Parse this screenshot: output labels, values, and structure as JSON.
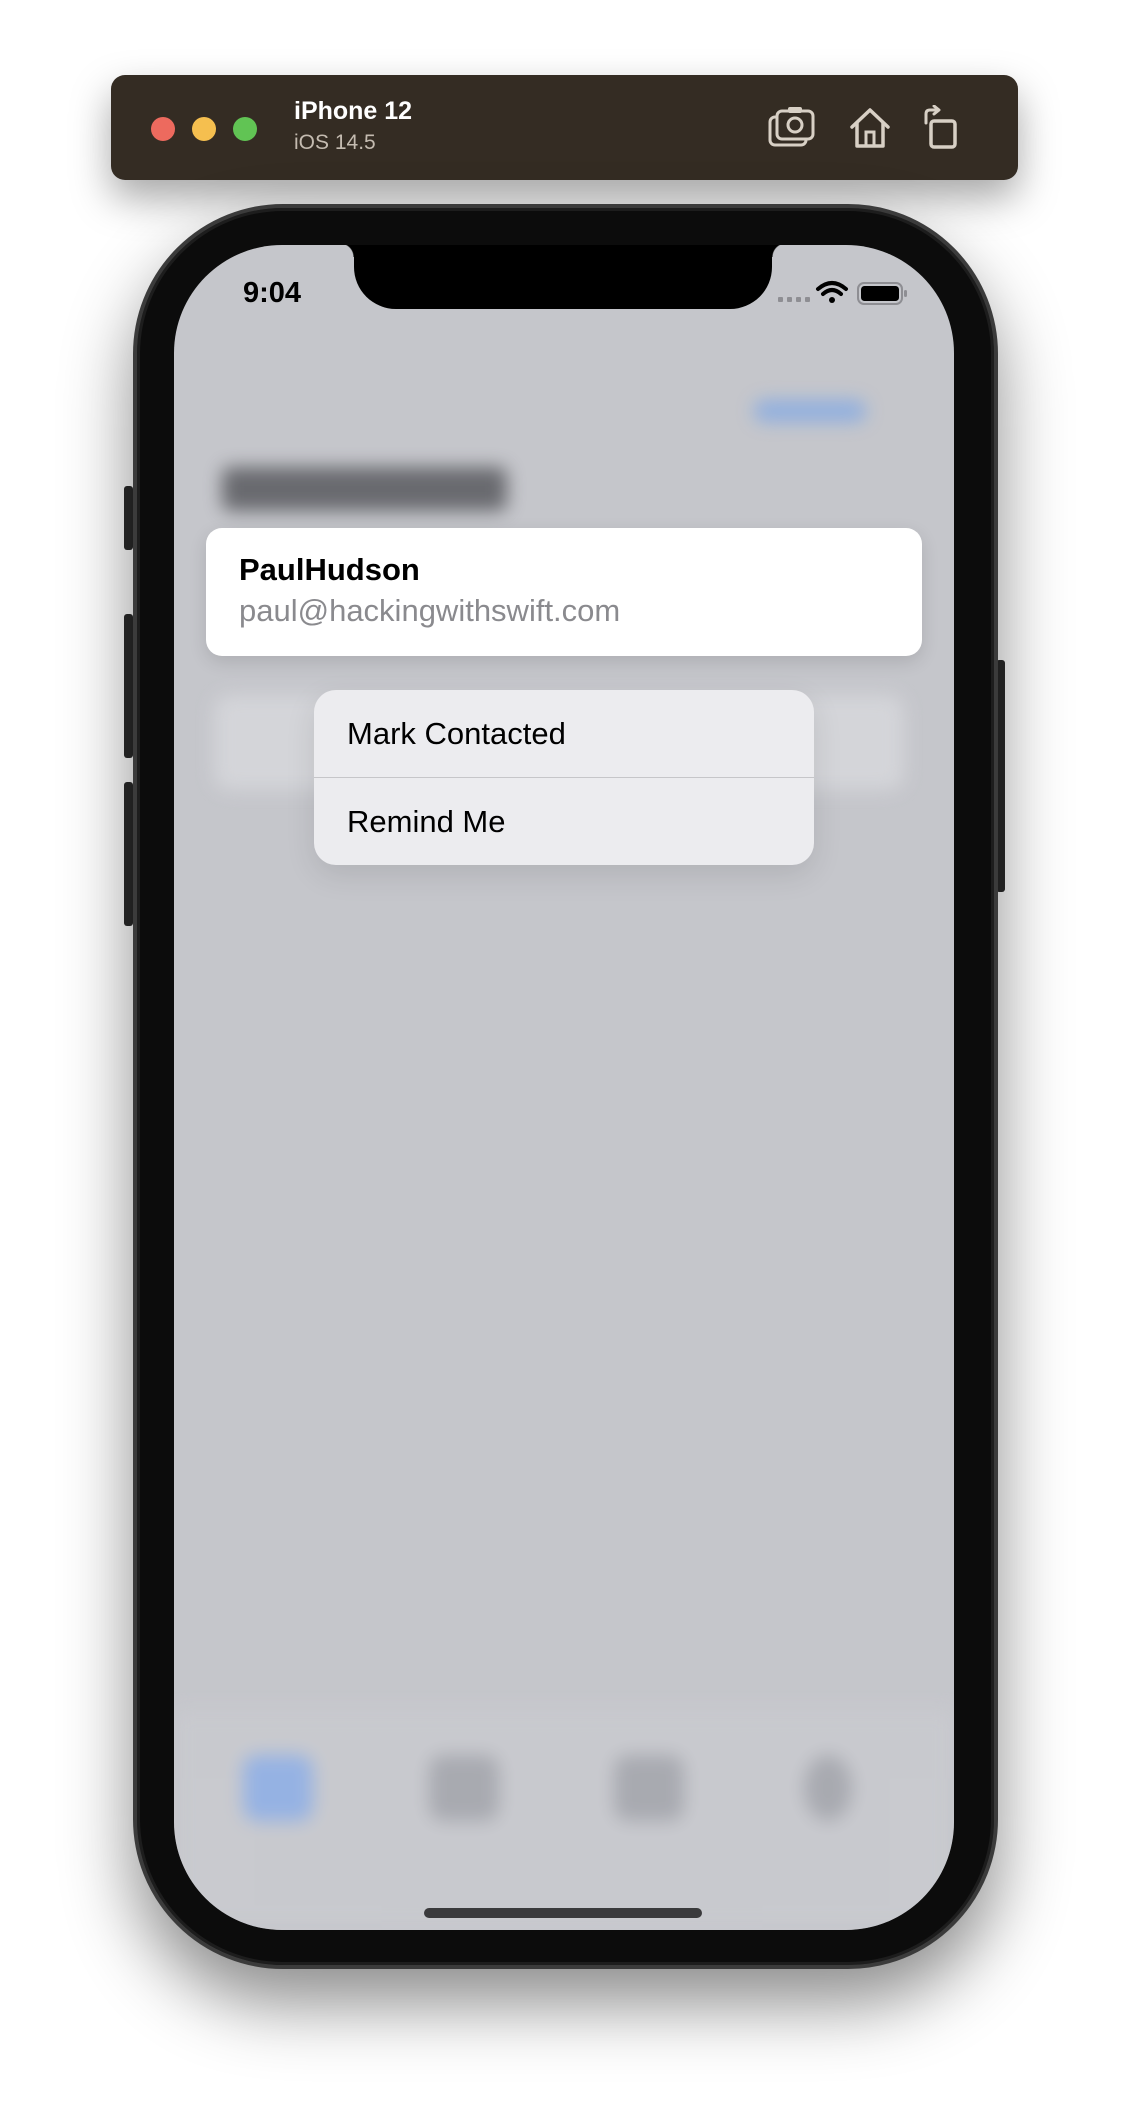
{
  "simulator": {
    "device_name": "iPhone 12",
    "os_version": "iOS 14.5",
    "toolbar": {
      "screenshot_icon": "camera-icon",
      "home_icon": "home-icon",
      "rotate_icon": "rotate-icon"
    }
  },
  "status_bar": {
    "time": "9:04",
    "icons": [
      "signal-icon",
      "wifi-icon",
      "battery-icon"
    ]
  },
  "preview_card": {
    "name": "PaulHudson",
    "email": "paul@hackingwithswift.com"
  },
  "context_menu": {
    "items": [
      {
        "label": "Mark Contacted"
      },
      {
        "label": "Remind Me"
      }
    ]
  },
  "colors": {
    "simulator_bar": "#342c23",
    "close": "#ed6a5e",
    "minimize": "#f5bf4f",
    "maximize": "#61c454",
    "screen_dimmed_background": "#c5c6cb",
    "menu_background": "#ececef",
    "email_text": "#8a8a8e"
  }
}
